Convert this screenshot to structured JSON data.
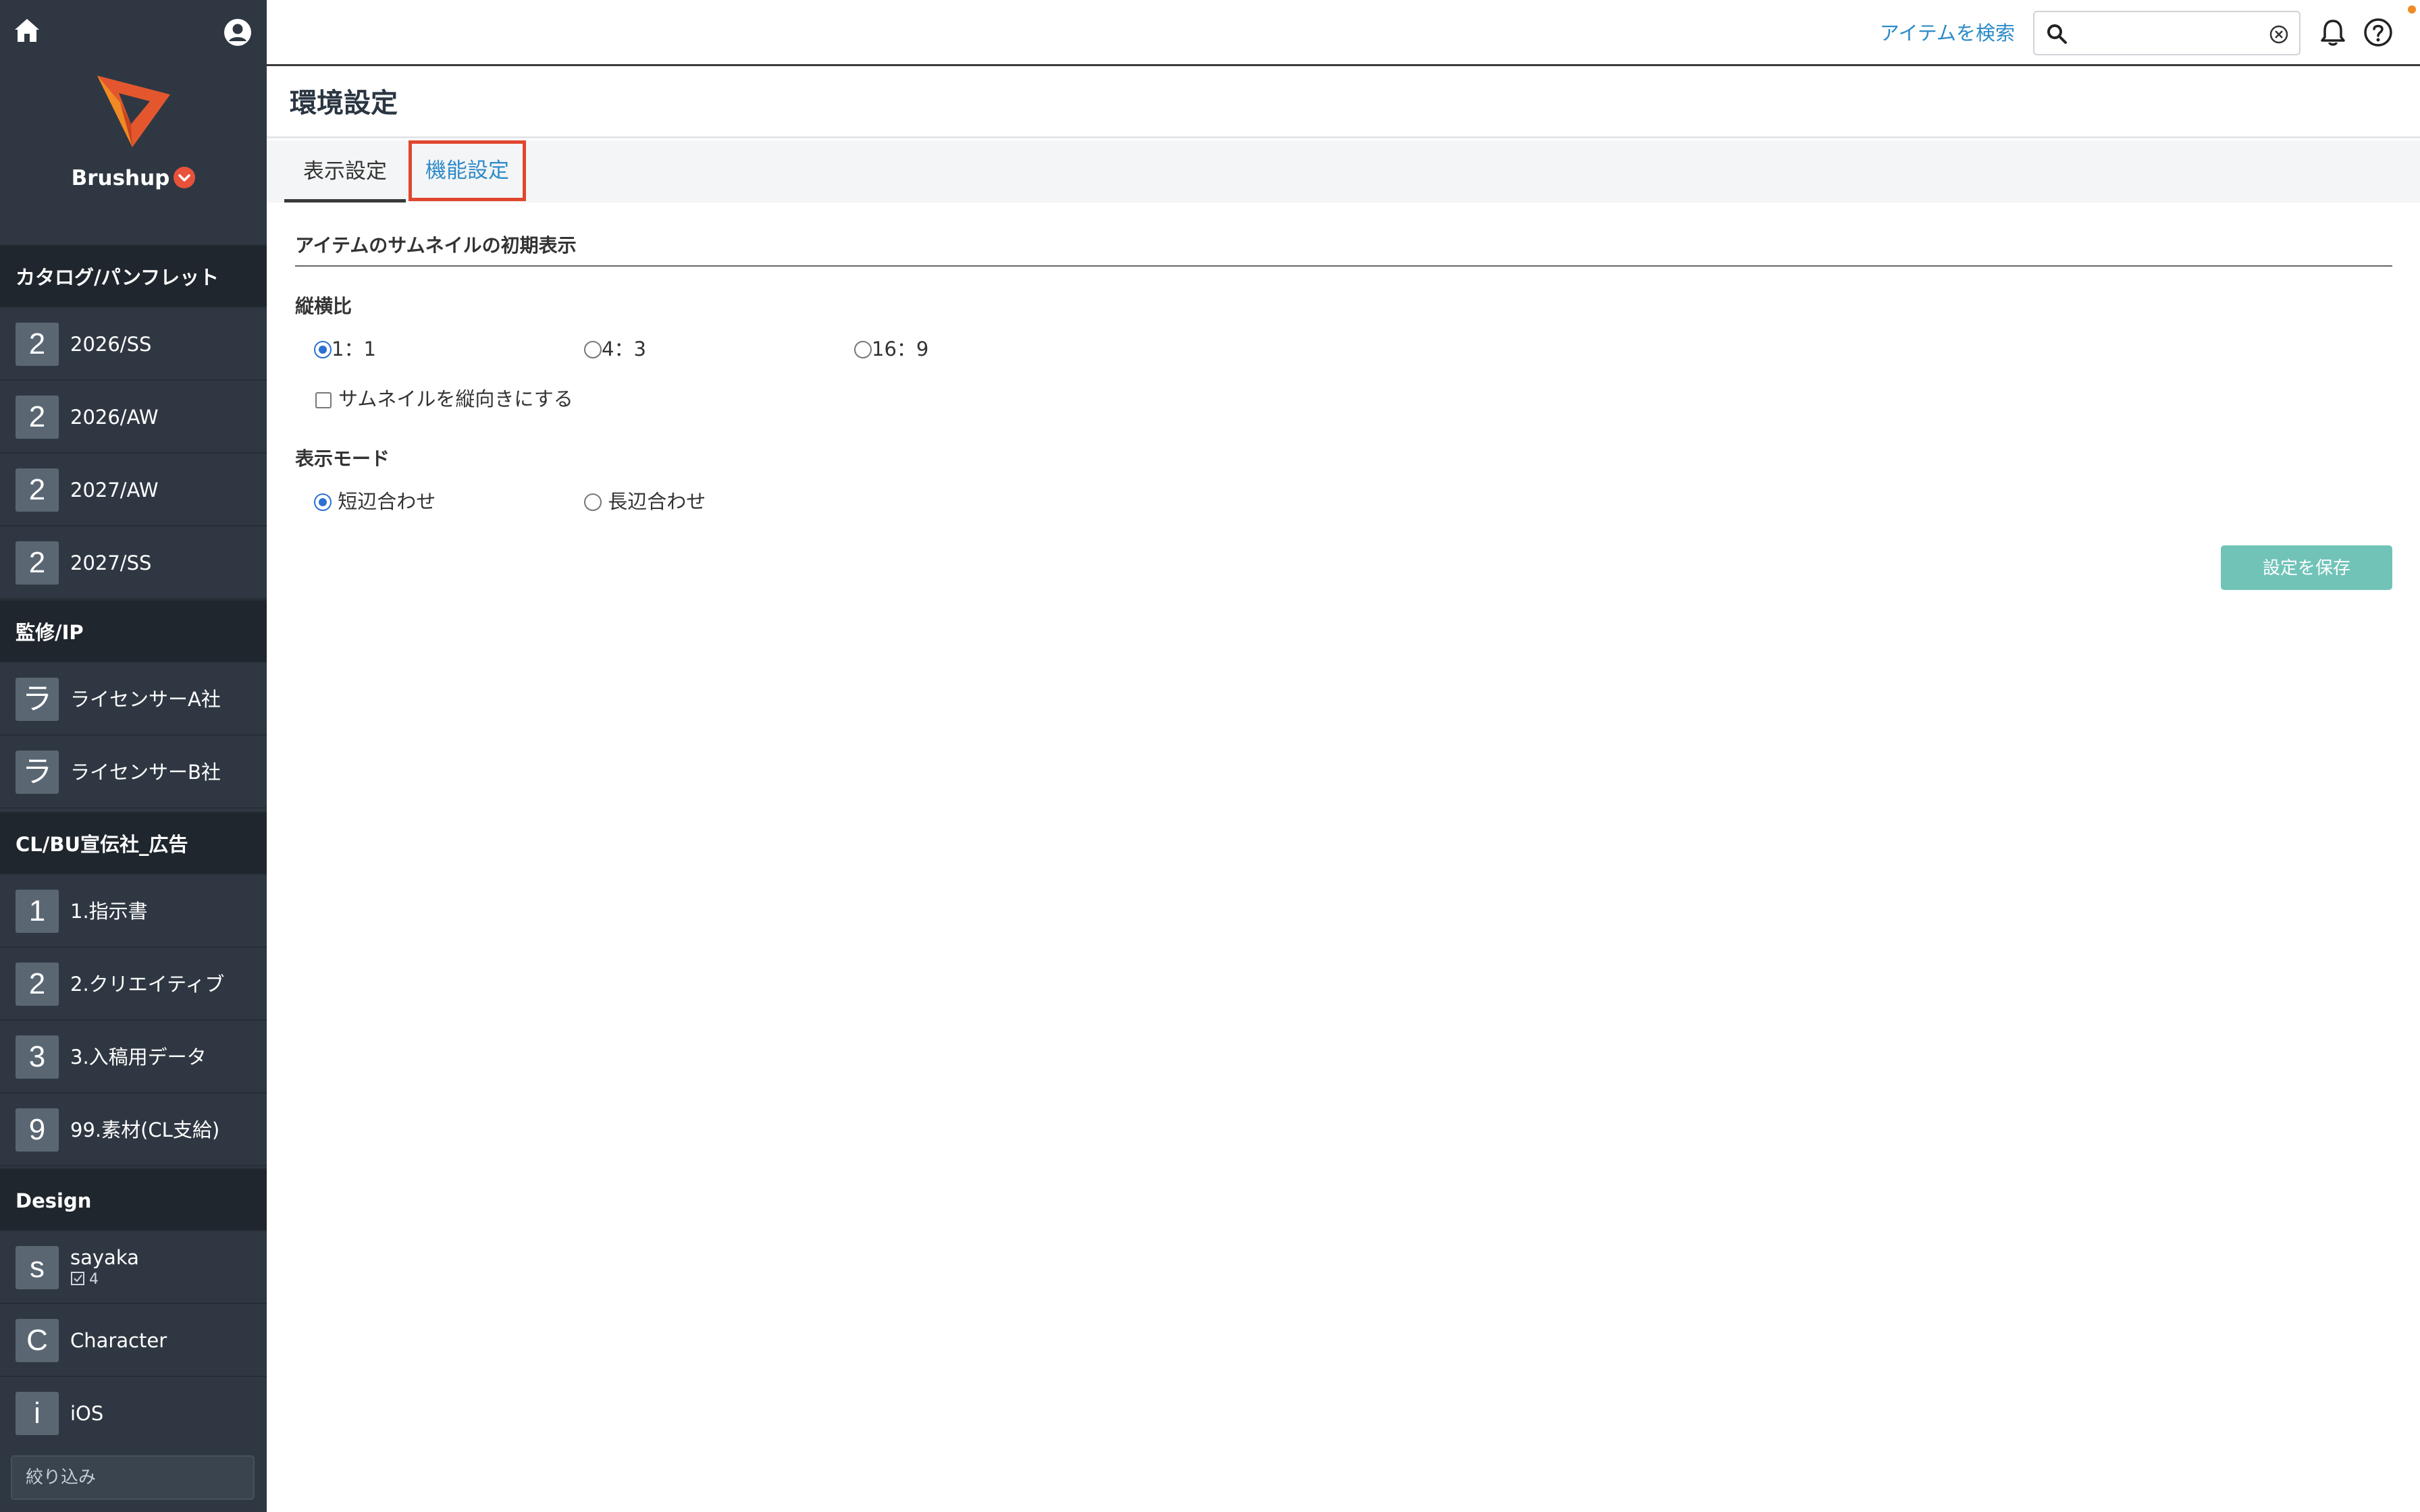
{
  "sidebar": {
    "brand": "Brushup",
    "groups": [
      {
        "title": "カタログ/パンフレット",
        "items": [
          {
            "avatar": "2",
            "label": "2026/SS"
          },
          {
            "avatar": "2",
            "label": "2026/AW"
          },
          {
            "avatar": "2",
            "label": "2027/AW"
          },
          {
            "avatar": "2",
            "label": "2027/SS"
          }
        ]
      },
      {
        "title": "監修/IP",
        "items": [
          {
            "avatar": "ラ",
            "label": "ライセンサーA社"
          },
          {
            "avatar": "ラ",
            "label": "ライセンサーB社"
          }
        ]
      },
      {
        "title": "CL/BU宣伝社_広告",
        "items": [
          {
            "avatar": "1",
            "label": "1.指示書"
          },
          {
            "avatar": "2",
            "label": "2.クリエイティブ"
          },
          {
            "avatar": "3",
            "label": "3.入稿用データ"
          },
          {
            "avatar": "9",
            "label": "99.素材(CL支給)"
          }
        ]
      },
      {
        "title": "Design",
        "items": [
          {
            "avatar": "s",
            "label": "sayaka",
            "sub": "4"
          },
          {
            "avatar": "C",
            "label": "Character"
          },
          {
            "avatar": "i",
            "label": "iOS"
          }
        ]
      }
    ],
    "filter_placeholder": "絞り込み"
  },
  "topbar": {
    "search_link": "アイテムを検索",
    "search_value": ""
  },
  "main": {
    "title": "環境設定",
    "tabs": [
      {
        "label": "表示設定"
      },
      {
        "label": "機能設定"
      }
    ],
    "section_title": "アイテムのサムネイルの初期表示",
    "aspect": {
      "label": "縦横比",
      "options": [
        "1：1",
        "4：3",
        "16：9"
      ],
      "selected": 0
    },
    "portrait_checkbox": {
      "label": "サムネイルを縦向きにする",
      "checked": false
    },
    "mode": {
      "label": "表示モード",
      "options": [
        "短辺合わせ",
        "長辺合わせ"
      ],
      "selected": 0
    },
    "save_label": "設定を保存"
  }
}
